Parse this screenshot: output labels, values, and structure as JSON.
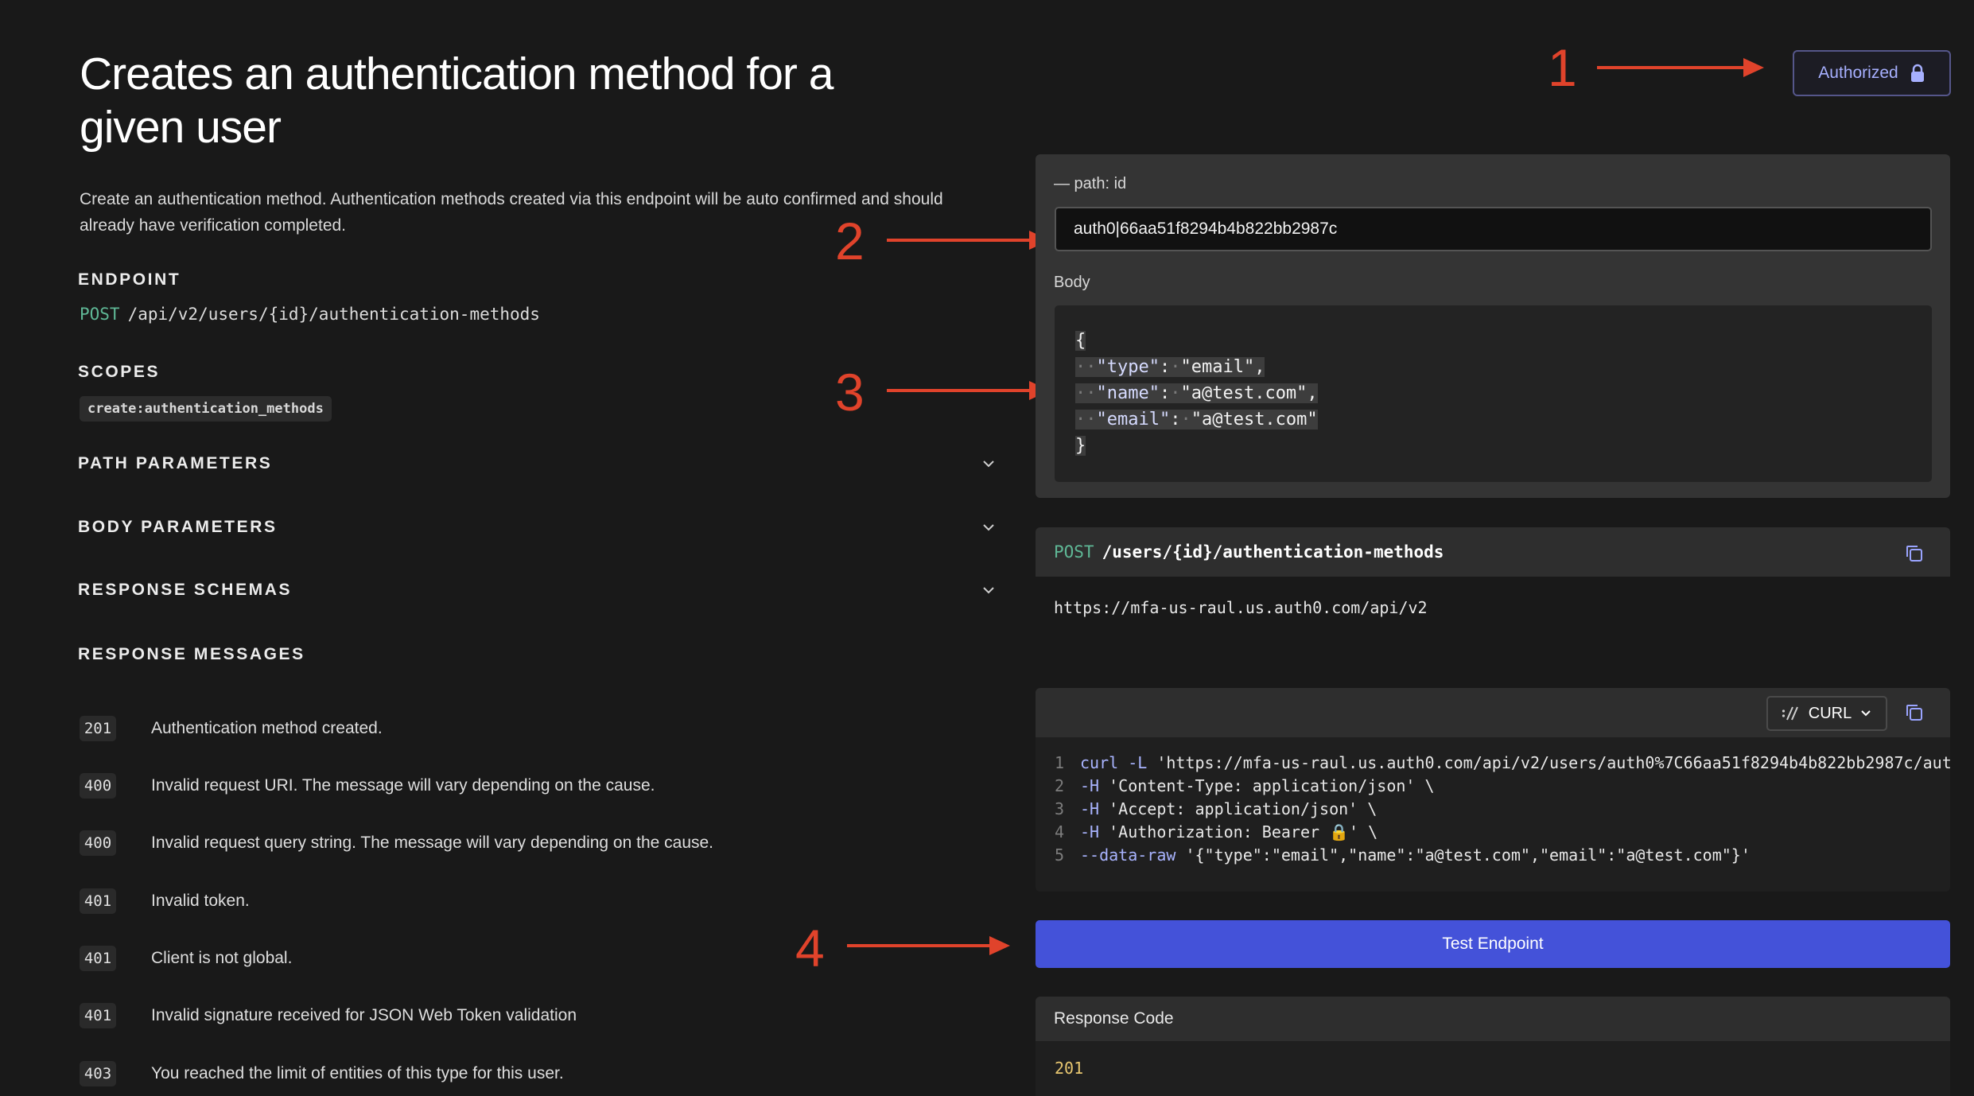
{
  "left": {
    "title": "Creates an authentication method for a given user",
    "description": "Create an authentication method. Authentication methods created via this endpoint will be auto confirmed and should already have verification completed.",
    "endpoint_label": "ENDPOINT",
    "endpoint_method": "POST",
    "endpoint_path": "/api/v2/users/{id}/authentication-methods",
    "scopes_label": "SCOPES",
    "scope": "create:authentication_methods",
    "sections": [
      "PATH PARAMETERS",
      "BODY PARAMETERS",
      "RESPONSE SCHEMAS"
    ],
    "response_messages_label": "RESPONSE MESSAGES",
    "responses": [
      {
        "code": "201",
        "text": "Authentication method created."
      },
      {
        "code": "400",
        "text": "Invalid request URI. The message will vary depending on the cause."
      },
      {
        "code": "400",
        "text": "Invalid request query string. The message will vary depending on the cause."
      },
      {
        "code": "401",
        "text": "Invalid token."
      },
      {
        "code": "401",
        "text": "Client is not global."
      },
      {
        "code": "401",
        "text": "Invalid signature received for JSON Web Token validation"
      },
      {
        "code": "403",
        "text": "You reached the limit of entities of this type for this user."
      }
    ]
  },
  "annotations": [
    "1",
    "2",
    "3",
    "4"
  ],
  "right": {
    "authorized_label": "Authorized",
    "path_label": "— path: id",
    "path_value": "auth0|66aa51f8294b4b822bb2987c",
    "body_label": "Body",
    "body_lines": [
      {
        "key": "\"type\"",
        "value": "\"email\","
      },
      {
        "key": "\"name\"",
        "value": "\"a@test.com\","
      },
      {
        "key": "\"email\"",
        "value": "\"a@test.com\""
      }
    ],
    "url_method": "POST",
    "url_path": "/users/{id}/authentication-methods",
    "base_url": "https://mfa-us-raul.us.auth0.com/api/v2",
    "language": "CURL",
    "code_lines": [
      {
        "n": "1",
        "cmd": "curl -L",
        "rest": " 'https://mfa-us-raul.us.auth0.com/api/v2/users/auth0%7C66aa51f8294b4b822bb2987c/aut"
      },
      {
        "n": "2",
        "cmd": "-H",
        "rest": " 'Content-Type: application/json' \\"
      },
      {
        "n": "3",
        "cmd": "-H",
        "rest": " 'Accept: application/json' \\"
      },
      {
        "n": "4",
        "cmd": "-H",
        "rest": " 'Authorization: Bearer 🔒' \\"
      },
      {
        "n": "5",
        "cmd": "--data-raw",
        "rest": " '{\"type\":\"email\",\"name\":\"a@test.com\",\"email\":\"a@test.com\"}'"
      }
    ],
    "test_button": "Test Endpoint",
    "response_code_label": "Response Code",
    "response_code_value": "201"
  },
  "colors": {
    "background": "#191919",
    "accent": "#4452d9",
    "annotation": "#e0432b",
    "post_method": "#5fb896"
  },
  "icons": [
    "lock-icon",
    "chevron-down-icon",
    "copy-icon",
    "curl-icon"
  ]
}
